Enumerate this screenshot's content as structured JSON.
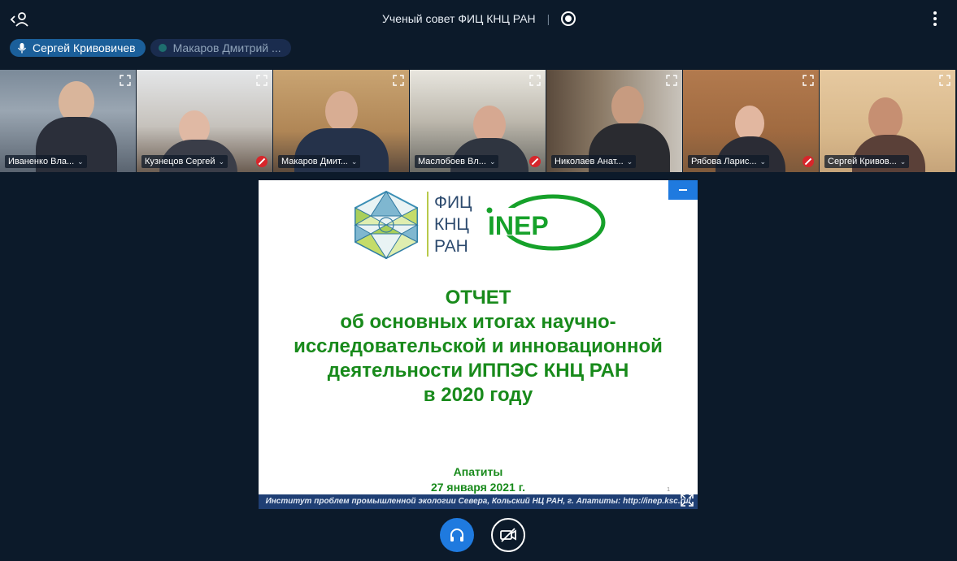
{
  "header": {
    "title": "Ученый совет ФИЦ КНЦ РАН",
    "separator": "|"
  },
  "speakers": [
    {
      "name": "Сергей Кривовичев",
      "active": true
    },
    {
      "name": "Макаров Дмитрий ...",
      "active": false
    }
  ],
  "participants": [
    {
      "name": "Иваненко Вла...",
      "muted": false
    },
    {
      "name": "Кузнецов Сергей",
      "muted": true
    },
    {
      "name": "Макаров Дмит...",
      "muted": false
    },
    {
      "name": "Маслобоев Вл...",
      "muted": true
    },
    {
      "name": "Николаев Анат...",
      "muted": false
    },
    {
      "name": "Рябова Ларис...",
      "muted": true
    },
    {
      "name": "Сергей Кривов...",
      "muted": false
    }
  ],
  "slide": {
    "logo_left_lines": [
      "ФИЦ",
      "КНЦ",
      "РАН"
    ],
    "logo_right_text": "INEP",
    "title_lines": [
      "ОТЧЕТ",
      "об основных итогах научно-",
      "исследовательской и инновационной",
      "деятельности ИППЭС КНЦ РАН",
      "в 2020 году"
    ],
    "place": "Апатиты",
    "date": "27 января 2021 г.",
    "footer": "Институт проблем промышленной экологии Севера, Кольский НЦ РАН, г. Апатиты: http://inep.ksc.ru/",
    "page_number": "1"
  },
  "colors": {
    "background": "#0c1a2a",
    "accent": "#1f7adf",
    "slide_green": "#188a1b",
    "muted_red": "#d7262b"
  }
}
